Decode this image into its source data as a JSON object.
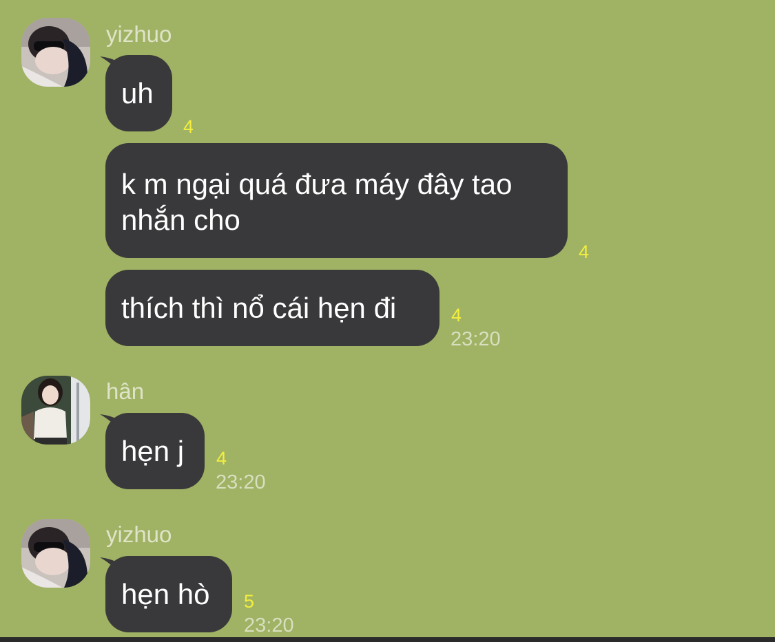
{
  "colors": {
    "background": "#a0b263",
    "bubble": "#39393b",
    "unread_count": "#f3ee3e",
    "timestamp": "#d8dfc0",
    "sender_name": "#dfe4c8"
  },
  "groups": [
    {
      "sender": "yizhuo",
      "avatar_icon": "avatar-photo-sunglasses",
      "messages": [
        {
          "text": "uh",
          "unread": "4",
          "time": ""
        },
        {
          "text": "k m ngại quá đưa máy đây tao nhắn cho",
          "unread": "4",
          "time": ""
        },
        {
          "text": "thích thì nổ cái hẹn đi",
          "unread": "4",
          "time": "23:20"
        }
      ]
    },
    {
      "sender": "hân",
      "avatar_icon": "avatar-photo-girl",
      "messages": [
        {
          "text": "hẹn j",
          "unread": "4",
          "time": "23:20"
        }
      ]
    },
    {
      "sender": "yizhuo",
      "avatar_icon": "avatar-photo-sunglasses",
      "messages": [
        {
          "text": "hẹn hò",
          "unread": "5",
          "time": "23:20"
        }
      ]
    }
  ]
}
